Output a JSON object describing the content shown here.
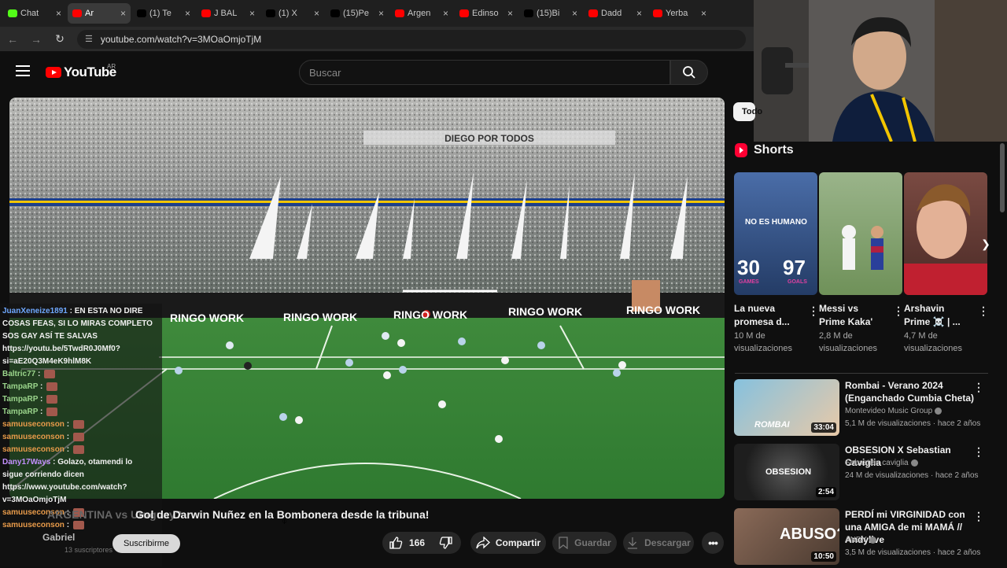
{
  "browser": {
    "tabs": [
      {
        "label": "Chat",
        "icon": "kick-icon",
        "color": "#53fc18",
        "active": false
      },
      {
        "label": "Ar",
        "icon": "youtube-icon",
        "color": "#ff0000",
        "active": true
      },
      {
        "label": "(1) Te",
        "icon": "x-icon",
        "color": "#000000",
        "active": false
      },
      {
        "label": "J BAL",
        "icon": "youtube-icon",
        "color": "#ff0000",
        "active": false
      },
      {
        "label": "(1) X",
        "icon": "x-icon",
        "color": "#000000",
        "active": false
      },
      {
        "label": "(15)Pe",
        "icon": "tiktok-icon",
        "color": "#000000",
        "active": false
      },
      {
        "label": "Argen",
        "icon": "youtube-icon",
        "color": "#ff0000",
        "active": false
      },
      {
        "label": "Edinso",
        "icon": "youtube-icon",
        "color": "#ff0000",
        "active": false
      },
      {
        "label": "(15)Bi",
        "icon": "tiktok-icon",
        "color": "#000000",
        "active": false
      },
      {
        "label": "Dadd",
        "icon": "youtube-icon",
        "color": "#ff0000",
        "active": false
      },
      {
        "label": "Yerba",
        "icon": "youtube-icon",
        "color": "#ff0000",
        "active": false
      }
    ],
    "url": "youtube.com/watch?v=3MOaOmjoTjM"
  },
  "header": {
    "logo_text": "YouTube",
    "region": "AR",
    "search_placeholder": "Buscar"
  },
  "video": {
    "overlay_banners": [
      "RINGO WORK",
      "RINGO WORK",
      "RINGO WORK",
      "RINGO WORK",
      "RINGO WORK"
    ],
    "stand_banner": "DIEGO POR TODOS"
  },
  "chat": {
    "messages": [
      {
        "user": "JuanXeneize1891",
        "text": "EN ESTA NO DIRE",
        "style": "blue"
      },
      {
        "user": "",
        "text": "COSAS FEAS, SI LO MIRAS COMPLETO",
        "style": ""
      },
      {
        "user": "",
        "text": "SOS GAY ASÍ TE SALVAS",
        "style": ""
      },
      {
        "user": "",
        "text": "https://youtu.be/5TwdR0J0Mf0?",
        "style": ""
      },
      {
        "user": "",
        "text": "si=aE20Q3M4eK9hlM8K",
        "style": ""
      },
      {
        "user": "Baltric77",
        "text": "",
        "style": "green"
      },
      {
        "user": "TampaRP",
        "text": "",
        "style": "green"
      },
      {
        "user": "TampaRP",
        "text": "",
        "style": "green"
      },
      {
        "user": "TampaRP",
        "text": "",
        "style": "green"
      },
      {
        "user": "samuuseconson",
        "text": "",
        "style": "orange"
      },
      {
        "user": "samuuseconson",
        "text": "",
        "style": "orange"
      },
      {
        "user": "samuuseconson",
        "text": "",
        "style": "orange"
      },
      {
        "user": "Dany17Ways",
        "text": "Golazo, otamendi lo",
        "style": "purple"
      },
      {
        "user": "",
        "text": "sigue corriendo dicen",
        "style": ""
      },
      {
        "user": "",
        "text": "https://www.youtube.com/watch?",
        "style": ""
      },
      {
        "user": "",
        "text": "v=3MOaOmjoTjM",
        "style": ""
      },
      {
        "user": "samuuseconson",
        "text": "",
        "style": "orange"
      },
      {
        "user": "samuuseconson",
        "text": "",
        "style": "orange"
      }
    ]
  },
  "watch": {
    "title_faded": "ARGENTINA vs Uruguay?",
    "title": "Gol de Darwin Nuñez en la Bombonera desde la tribuna!",
    "channel_name": "Gabriel",
    "subscribers": "13 suscriptores",
    "subscribe_label": "Suscribirme",
    "likes": "166",
    "share_label": "Compartir",
    "save_label": "Guardar",
    "download_label": "Descargar"
  },
  "sidebar": {
    "chip_label": "Todo",
    "shorts_title": "Shorts",
    "shorts": [
      {
        "title": "La nueva promesa d...",
        "views": "10 M de visualizaciones",
        "overlay_top": "NO ES HUMANO",
        "stat_left": "30",
        "stat_left_label": "GAMES",
        "stat_right": "97",
        "stat_right_label": "GOALS",
        "bg": "#3a5a8c"
      },
      {
        "title": "Messi vs Prime Kaka'",
        "views": "2,8 M de visualizaciones",
        "bg": "#8fa878"
      },
      {
        "title": "Arshavin Prime ☠️ | ...",
        "views": "4,7 M de visualizaciones",
        "bg": "#6b3a36"
      }
    ],
    "videos": [
      {
        "title": "Rombai - Verano 2024 (Enganchado Cumbia Cheta)",
        "channel": "Montevideo Music Group",
        "meta": "5,1 M de visualizaciones · hace 2 años",
        "duration": "33:04",
        "thumb_text": "ROMBAI",
        "bg": "#3d7fa6"
      },
      {
        "title": "OBSESION X Sebastian Caviglia",
        "channel": "Sebastian caviglia",
        "meta": "24 M de visualizaciones · hace 2 años",
        "duration": "2:54",
        "thumb_text": "OBSESION",
        "bg": "#202020"
      },
      {
        "title": "PERDÍ mi VIRGINIDAD con una AMIGA de mi MAMÁ // Andylive",
        "channel": "ANDY",
        "meta": "3,5 M de visualizaciones · hace 2 años",
        "duration": "10:50",
        "thumb_text": "ABUSO?",
        "bg": "#6b4a3a"
      }
    ]
  }
}
